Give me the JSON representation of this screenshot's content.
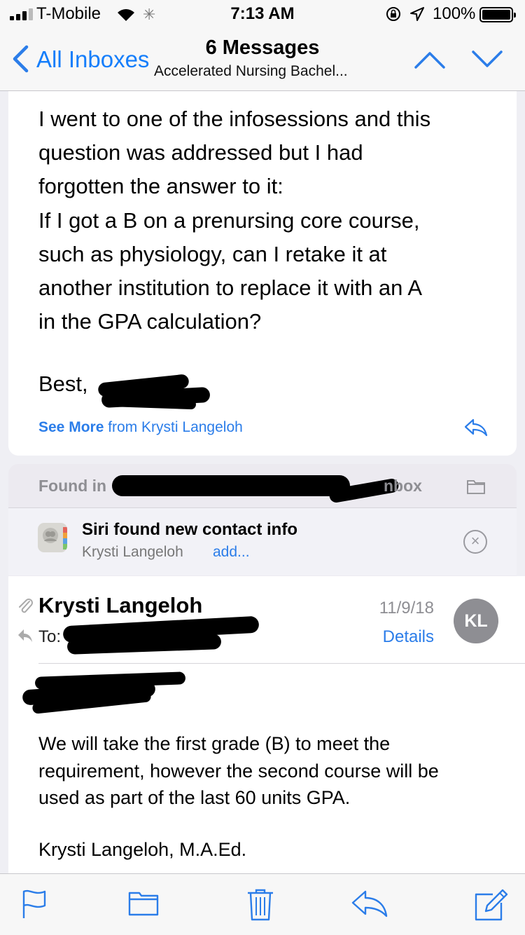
{
  "status_bar": {
    "carrier": "T-Mobile",
    "time": "7:13 AM",
    "battery": "100%"
  },
  "nav": {
    "back_label": "All Inboxes",
    "title": "6 Messages",
    "subtitle": "Accelerated Nursing Bachel..."
  },
  "message1": {
    "body_lines": [
      "I went to one of the infosessions and this",
      "question was addressed but I had",
      "forgotten the answer to it:",
      "If I got a B on a prenursing core course,",
      "such as physiology, can I retake it at",
      "another institution to replace it with an A",
      "in the GPA calculation?"
    ],
    "closing": "Best,",
    "see_more_label": "See More",
    "see_more_from": "from Krysti Langeloh"
  },
  "found": {
    "label": "Found in",
    "end_fragment": "nbox"
  },
  "siri": {
    "title": "Siri found new contact info",
    "contact_name": "Krysti Langeloh",
    "add_label": "add..."
  },
  "message2": {
    "sender": "Krysti Langeloh",
    "date": "11/9/18",
    "avatar_initials": "KL",
    "to_label": "To:",
    "details_label": "Details",
    "body_lines": [
      "We will take the first grade (B) to meet the",
      "requirement, however the second course will be",
      "used as part of the last 60 units GPA."
    ],
    "signature": "Krysti Langeloh, M.A.Ed."
  },
  "toolbar": {
    "icons": [
      "flag-icon",
      "folder-icon",
      "trash-icon",
      "reply-icon",
      "compose-icon"
    ]
  },
  "colors": {
    "accent": "#2b7de9",
    "secondary_text": "#8e8e93",
    "bar_background": "#f7f7f7"
  }
}
